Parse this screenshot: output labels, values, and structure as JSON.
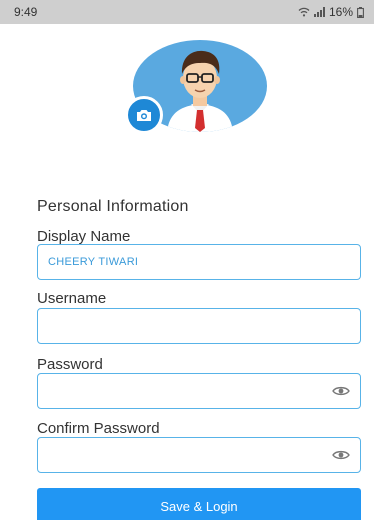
{
  "status_bar": {
    "time": "9:49",
    "battery": "16%",
    "icons": [
      "wifi-icon",
      "signal-icon",
      "battery-icon"
    ]
  },
  "profile": {
    "avatar": "male-avatar-illustration",
    "camera_icon": "camera-icon"
  },
  "form": {
    "section_title": "Personal Information",
    "display_name_label": "Display Name",
    "display_name_value": "CHEERY TIWARI",
    "username_label": "Username",
    "username_value": "",
    "password_label": "Password",
    "password_value": "",
    "confirm_password_label": "Confirm Password",
    "confirm_password_value": ""
  },
  "actions": {
    "save_label": "Save & Login"
  },
  "colors": {
    "accent": "#2196f3",
    "field_border": "#58b3e8",
    "status_bar": "#cfcfcf"
  }
}
